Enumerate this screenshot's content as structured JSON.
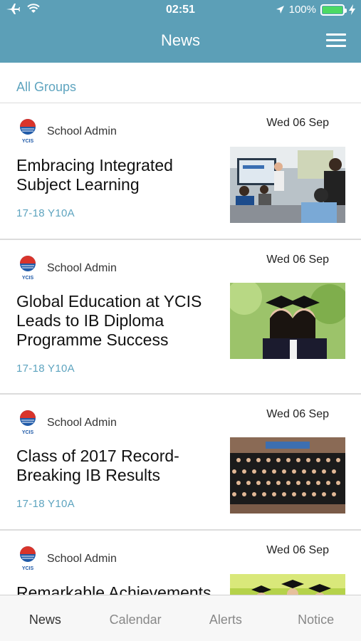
{
  "status_bar": {
    "time": "02:51",
    "battery": "100%"
  },
  "header": {
    "title": "News"
  },
  "groups_link": "All Groups",
  "news": [
    {
      "author": "School Admin",
      "date": "Wed 06 Sep",
      "headline": "Embracing Integrated Subject Learning",
      "group": "17-18 Y10A"
    },
    {
      "author": "School Admin",
      "date": "Wed 06 Sep",
      "headline": "Global Education at YCIS Leads to IB Diploma Programme Success",
      "group": "17-18 Y10A"
    },
    {
      "author": "School Admin",
      "date": "Wed 06 Sep",
      "headline": "Class of 2017 Record-Breaking IB Results",
      "group": "17-18 Y10A"
    },
    {
      "author": "School Admin",
      "date": "Wed 06 Sep",
      "headline": "Remarkable Achievements",
      "group": ""
    }
  ],
  "logo_text": "YCIS",
  "tabs": [
    "News",
    "Calendar",
    "Alerts",
    "Notice"
  ],
  "colors": {
    "header": "#5c9fb7",
    "accent": "#5ea4bf",
    "battery": "#4cd964"
  }
}
